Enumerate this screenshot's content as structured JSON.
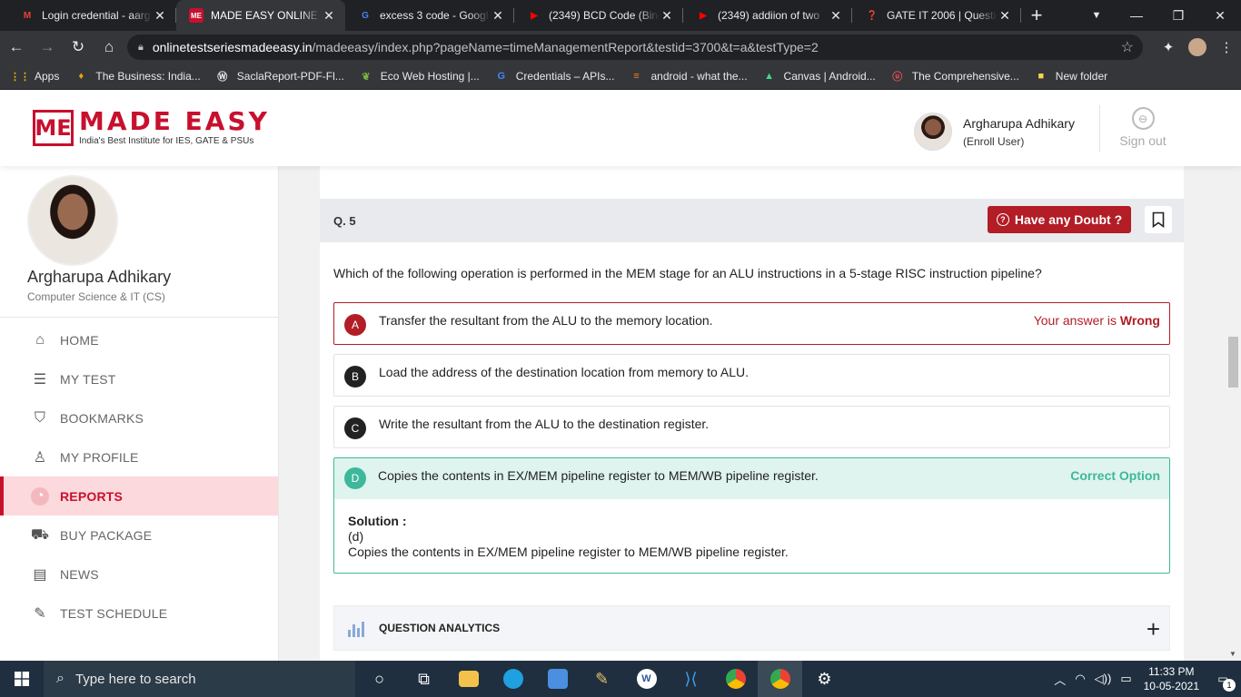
{
  "browser": {
    "tabs": [
      {
        "title": "Login credential - aarg",
        "favicon": "gmail-icon",
        "color": "#ea4335",
        "glyph": "M"
      },
      {
        "title": "MADE EASY ONLINE T",
        "favicon": "madeeasy-icon",
        "color": "#c8102e",
        "glyph": "ME",
        "active": true
      },
      {
        "title": "excess 3 code - Googl",
        "favicon": "google-icon",
        "color": "#4285f4",
        "glyph": "G"
      },
      {
        "title": "(2349) BCD Code (Bina",
        "favicon": "youtube-icon",
        "color": "#ff0000",
        "glyph": "▶"
      },
      {
        "title": "(2349) addiion of two",
        "favicon": "youtube-icon",
        "color": "#ff0000",
        "glyph": "▶"
      },
      {
        "title": "GATE IT 2006 | Questic",
        "favicon": "gateoverflow-icon",
        "color": "#d33",
        "glyph": "❓"
      }
    ],
    "url_host": "onlinetestseriesmadeeasy.in",
    "url_path": "/madeeasy/index.php?pageName=timeManagementReport&testid=3700&t=a&testType=2",
    "bookmarks": [
      {
        "label": "Apps",
        "icon": "apps-grid-icon",
        "glyph": "⋮⋮",
        "color": "#f4b400"
      },
      {
        "label": "The Business: India...",
        "icon": "business-icon",
        "glyph": "♦",
        "color": "#e8a317"
      },
      {
        "label": "SaclaReport-PDF-Fl...",
        "icon": "wordpress-icon",
        "glyph": "Ⓦ",
        "color": "#e8eaed"
      },
      {
        "label": "Eco Web Hosting |...",
        "icon": "eco-leaf-icon",
        "glyph": "❦",
        "color": "#7cb342"
      },
      {
        "label": "Credentials – APIs...",
        "icon": "google-icon",
        "glyph": "G",
        "color": "#4285f4"
      },
      {
        "label": "android - what the...",
        "icon": "stackoverflow-icon",
        "glyph": "≡",
        "color": "#f48024"
      },
      {
        "label": "Canvas | Android...",
        "icon": "android-icon",
        "glyph": "▲",
        "color": "#3ddc84"
      },
      {
        "label": "The Comprehensive...",
        "icon": "udemy-icon",
        "glyph": "ⓤ",
        "color": "#ec5252"
      },
      {
        "label": "New folder",
        "icon": "folder-icon",
        "glyph": "■",
        "color": "#f9d54a"
      }
    ]
  },
  "header": {
    "logo_name": "MADE EASY",
    "logo_mark": "ME",
    "logo_tag": "India's Best Institute for IES, GATE & PSUs",
    "user_name": "Argharupa Adhikary",
    "user_role": "(Enroll User)",
    "signout_label": "Sign out"
  },
  "sidebar": {
    "name": "Argharupa Adhikary",
    "course": "Computer Science & IT (CS)",
    "menu": [
      {
        "label": "HOME",
        "icon": "home-icon",
        "glyph": "⌂"
      },
      {
        "label": "MY TEST",
        "icon": "test-list-icon",
        "glyph": "☰"
      },
      {
        "label": "BOOKMARKS",
        "icon": "bookmark-icon",
        "glyph": "⛉"
      },
      {
        "label": "MY PROFILE",
        "icon": "user-icon",
        "glyph": "♙"
      },
      {
        "label": "REPORTS",
        "icon": "pie-chart-icon",
        "glyph": "◔",
        "active": true
      },
      {
        "label": "BUY PACKAGE",
        "icon": "cart-icon",
        "glyph": "⛟"
      },
      {
        "label": "NEWS",
        "icon": "newspaper-icon",
        "glyph": "▤"
      },
      {
        "label": "TEST SCHEDULE",
        "icon": "schedule-icon",
        "glyph": "✎"
      }
    ]
  },
  "question": {
    "number": "Q. 5",
    "doubt_label": "Have any Doubt ?",
    "text": "Which of the following operation is performed in the MEM stage for an ALU instructions in a 5-stage RISC instruction pipeline?",
    "options": [
      {
        "letter": "A",
        "text": "Transfer the resultant from the ALU to the memory location.",
        "status": "wrong",
        "tag_prefix": "Your answer is ",
        "tag_strong": "Wrong"
      },
      {
        "letter": "B",
        "text": "Load the address of the destination location from memory to ALU.",
        "status": "none"
      },
      {
        "letter": "C",
        "text": "Write the resultant from the ALU to the destination register.",
        "status": "none"
      },
      {
        "letter": "D",
        "text": "Copies the contents in EX/MEM pipeline register to MEM/WB pipeline register.",
        "status": "correct",
        "tag": "Correct Option"
      }
    ],
    "solution_label": "Solution :",
    "solution_answer": "(d)",
    "solution_text": "Copies the contents in EX/MEM pipeline register to MEM/WB pipeline register."
  },
  "analytics": {
    "label": "QUESTION ANALYTICS"
  },
  "taskbar": {
    "search_placeholder": "Type here to search",
    "time": "11:33 PM",
    "date": "10-05-2021",
    "notifications": "1"
  },
  "colors": {
    "brand": "#c8102e",
    "doubt": "#b21d26",
    "correct": "#3db89b"
  }
}
